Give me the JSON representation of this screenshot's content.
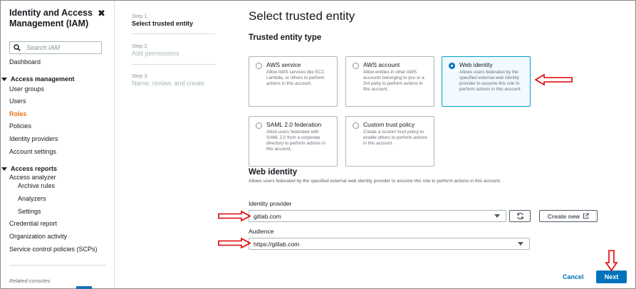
{
  "sidebar": {
    "title": "Identity and Access Management (IAM)",
    "close_icon": "close-icon",
    "search_placeholder": "Search IAM",
    "dashboard": "Dashboard",
    "access_management": {
      "heading": "Access management",
      "items": [
        "User groups",
        "Users",
        "Roles",
        "Policies",
        "Identity providers",
        "Account settings"
      ],
      "active": "Roles"
    },
    "access_reports": {
      "heading": "Access reports",
      "items": [
        "Access analyzer",
        "Archive rules",
        "Analyzers",
        "Settings",
        "Credential report",
        "Organization activity",
        "Service control policies (SCPs)"
      ]
    },
    "footer": "Related consoles"
  },
  "steps": [
    {
      "label": "Step 1",
      "title": "Select trusted entity",
      "state": "current"
    },
    {
      "label": "Step 2",
      "title": "Add permissions",
      "state": "future"
    },
    {
      "label": "Step 3",
      "title": "Name, review, and create",
      "state": "future"
    }
  ],
  "main": {
    "title": "Select trusted entity",
    "entity_type_heading": "Trusted entity type",
    "entity_types": [
      {
        "title": "AWS service",
        "description": "Allow AWS services like EC2, Lambda, or others to perform actions in this account.",
        "selected": false
      },
      {
        "title": "AWS account",
        "description": "Allow entities in other AWS accounts belonging to you or a 3rd party to perform actions in this account.",
        "selected": false
      },
      {
        "title": "Web identity",
        "description": "Allows users federated by the specified external web identity provider to assume this role to perform actions in this account.",
        "selected": true
      },
      {
        "title": "SAML 2.0 federation",
        "description": "Allow users federated with SAML 2.0 from a corporate directory to perform actions in this account.",
        "selected": false
      },
      {
        "title": "Custom trust policy",
        "description": "Create a custom trust policy to enable others to perform actions in this account.",
        "selected": false
      }
    ],
    "web_identity": {
      "heading": "Web identity",
      "description": "Allows users federated by the specified external web identity provider to assume this role to perform actions in this account.",
      "provider_label": "Identity provider",
      "provider_value": "gitlab.com",
      "audience_label": "Audience",
      "audience_value": "https://gitlab.com",
      "create_new_label": "Create new"
    },
    "footer": {
      "cancel_label": "Cancel",
      "next_label": "Next"
    }
  },
  "colors": {
    "accent_blue": "#0073bb",
    "active_nav": "#ec7211",
    "annotation_red": "#e00000"
  }
}
